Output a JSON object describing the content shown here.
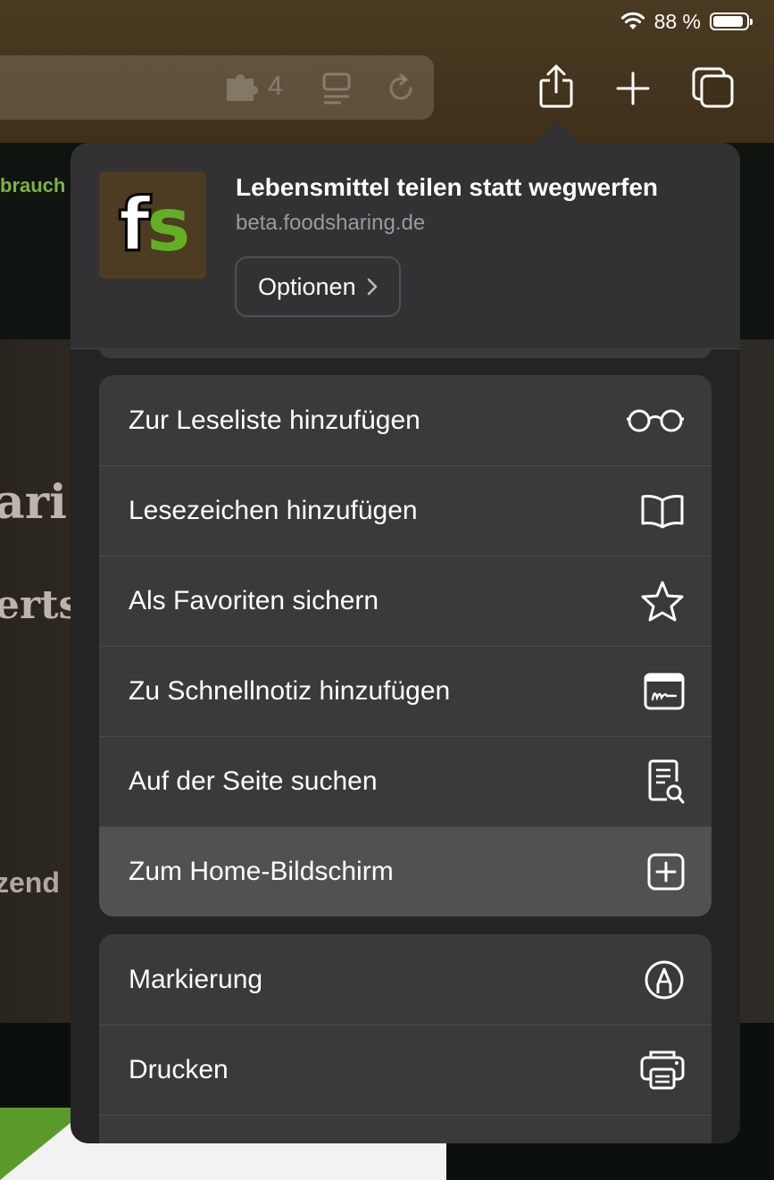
{
  "status_bar": {
    "battery_text": "88 %",
    "battery_level": 0.88
  },
  "address_bar": {
    "extension_count": "4"
  },
  "background_page": {
    "link_fragment": "brauch",
    "heading_fragment_1": "ari",
    "heading_fragment_2": "erts",
    "text_fragment": "zend"
  },
  "share_sheet": {
    "title": "Lebensmittel teilen statt wegwerfen",
    "domain": "beta.foodsharing.de",
    "options_label": "Optionen",
    "app_icon_letters": [
      "f",
      "s"
    ],
    "colors": {
      "sheet_bg": "#242426",
      "row_bg": "#3a3a3c",
      "highlight_bg": "#515154",
      "brand_green": "#64ae24",
      "brand_brown": "#4d3b22"
    },
    "group1": [
      {
        "label": "Zur Leseliste hinzufügen",
        "icon": "reading-glasses-icon"
      },
      {
        "label": "Lesezeichen hinzufügen",
        "icon": "book-icon"
      },
      {
        "label": "Als Favoriten sichern",
        "icon": "star-icon"
      },
      {
        "label": "Zu Schnellnotiz hinzufügen",
        "icon": "quick-note-icon"
      },
      {
        "label": "Auf der Seite suchen",
        "icon": "find-on-page-icon"
      },
      {
        "label": "Zum Home-Bildschirm",
        "icon": "add-square-icon",
        "highlighted": true
      }
    ],
    "group2": [
      {
        "label": "Markierung",
        "icon": "markup-pen-icon"
      },
      {
        "label": "Drucken",
        "icon": "printer-icon"
      }
    ]
  }
}
